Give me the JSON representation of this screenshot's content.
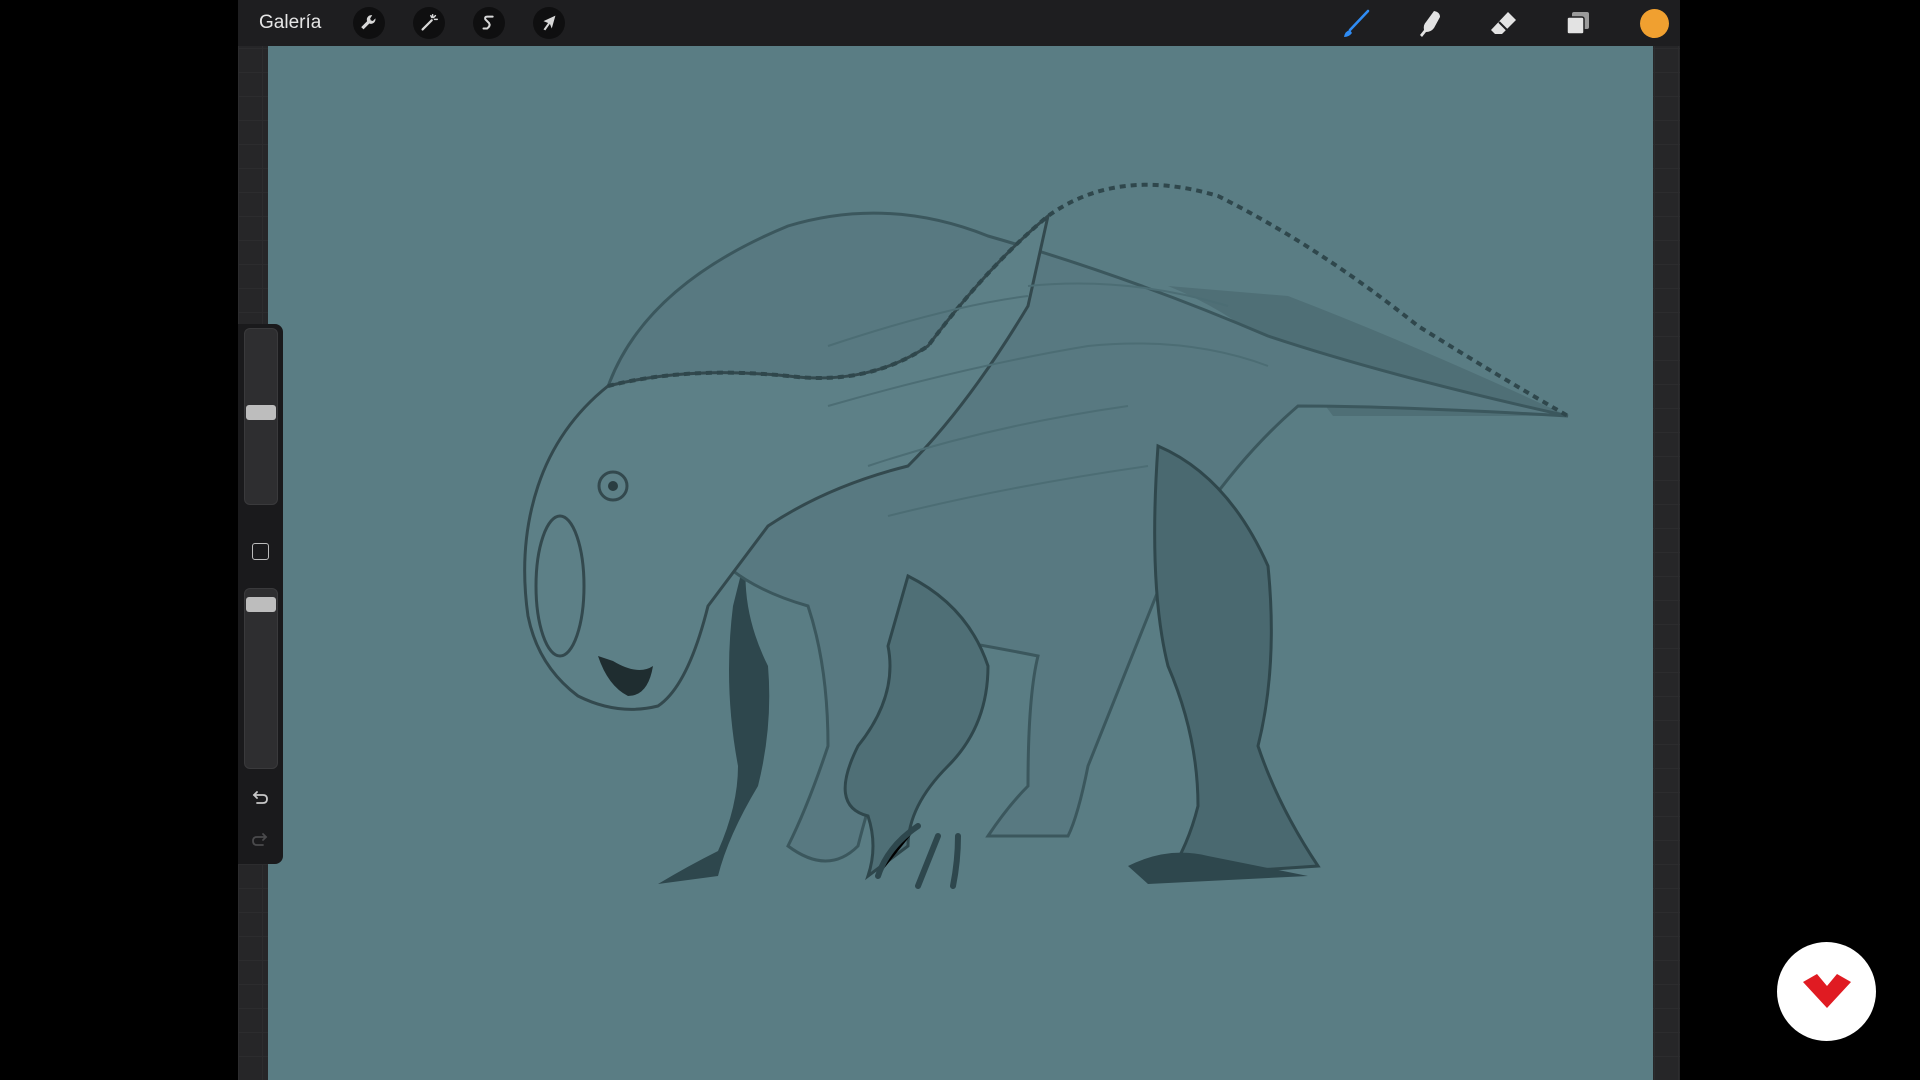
{
  "topbar": {
    "gallery_label": "Galería",
    "left_tools": [
      {
        "name": "actions",
        "icon": "wrench-icon"
      },
      {
        "name": "adjustments",
        "icon": "magic-wand-icon"
      },
      {
        "name": "selection",
        "icon": "selection-s-icon"
      },
      {
        "name": "transform",
        "icon": "arrow-cursor-icon"
      }
    ],
    "right_tools": [
      {
        "name": "brush",
        "icon": "brush-icon",
        "active": true
      },
      {
        "name": "smudge",
        "icon": "smudge-finger-icon"
      },
      {
        "name": "eraser",
        "icon": "eraser-icon"
      },
      {
        "name": "layers",
        "icon": "layers-icon"
      }
    ],
    "current_color": "#f0a030",
    "accent_color": "#2f8cf4"
  },
  "sidebar": {
    "brush_size_level": 0.52,
    "opacity_level": 0.95,
    "undo_icon": "undo-arrow-icon",
    "redo_icon": "redo-arrow-icon",
    "modify_icon": "square-icon"
  },
  "canvas": {
    "background_color": "#5a7d84",
    "subject": "dinosaur-drawing"
  },
  "overlay": {
    "logo_icon": "domestika-logo-icon",
    "logo_color": "#e01b22"
  }
}
